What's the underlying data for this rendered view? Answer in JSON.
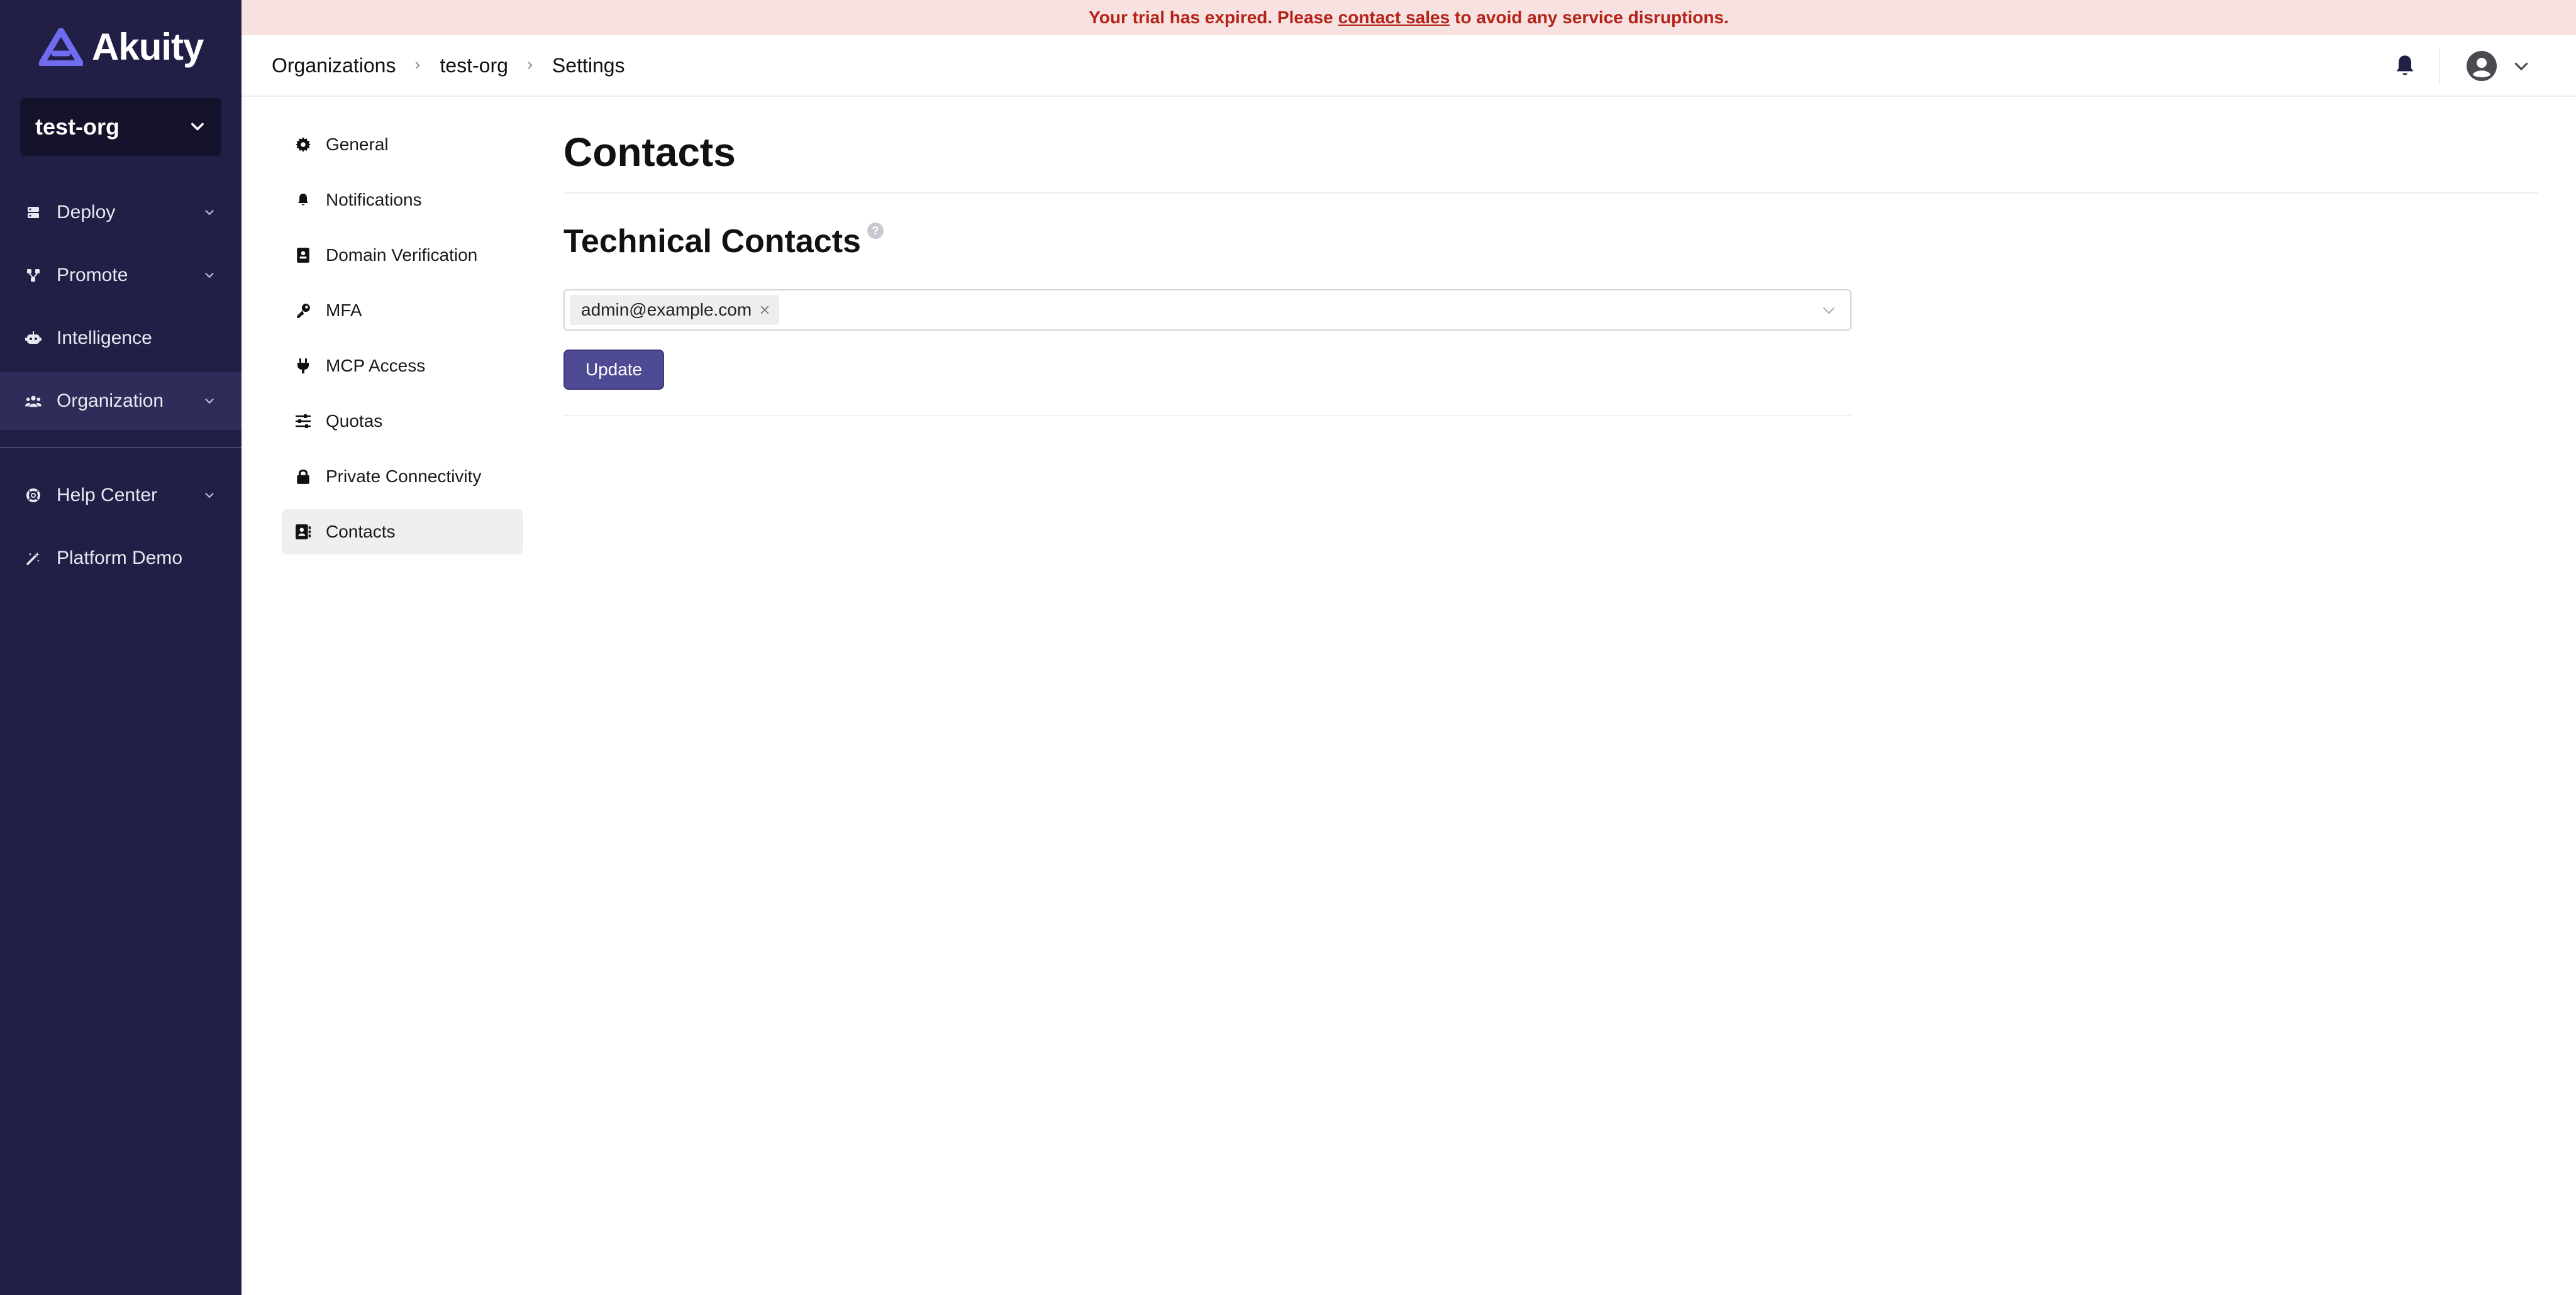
{
  "app": {
    "brand": "Akuity",
    "org_selector": "test-org"
  },
  "sidebar": {
    "items": [
      {
        "label": "Deploy",
        "icon": "stack-icon",
        "has_children": true
      },
      {
        "label": "Promote",
        "icon": "flow-icon",
        "has_children": true
      },
      {
        "label": "Intelligence",
        "icon": "robot-icon",
        "has_children": false
      },
      {
        "label": "Organization",
        "icon": "users-icon",
        "has_children": true,
        "active": true
      },
      {
        "label": "Help Center",
        "icon": "lifebuoy-icon",
        "has_children": true
      },
      {
        "label": "Platform Demo",
        "icon": "magic-wand-icon",
        "has_children": false
      }
    ]
  },
  "banner": {
    "prefix": "Your trial has expired. Please",
    "link": "contact sales",
    "suffix": "to avoid any service disruptions."
  },
  "breadcrumb": [
    "Organizations",
    "test-org",
    "Settings"
  ],
  "settings_nav": {
    "items": [
      {
        "label": "General",
        "icon": "gear-icon"
      },
      {
        "label": "Notifications",
        "icon": "bell-icon"
      },
      {
        "label": "Domain Verification",
        "icon": "id-badge-icon"
      },
      {
        "label": "MFA",
        "icon": "key-icon"
      },
      {
        "label": "MCP Access",
        "icon": "plug-icon"
      },
      {
        "label": "Quotas",
        "icon": "sliders-icon"
      },
      {
        "label": "Private Connectivity",
        "icon": "lock-icon"
      },
      {
        "label": "Contacts",
        "icon": "contact-book-icon",
        "active": true
      }
    ]
  },
  "main": {
    "page_title": "Contacts",
    "section_title": "Technical Contacts",
    "help_glyph": "?",
    "contacts": [
      "admin@example.com"
    ],
    "update_label": "Update"
  },
  "colors": {
    "sidebar_bg": "#211f45",
    "accent": "#4e4a93",
    "banner_bg": "#f8e1e1",
    "banner_text": "#b42318",
    "logo": "#6f6cf0"
  }
}
